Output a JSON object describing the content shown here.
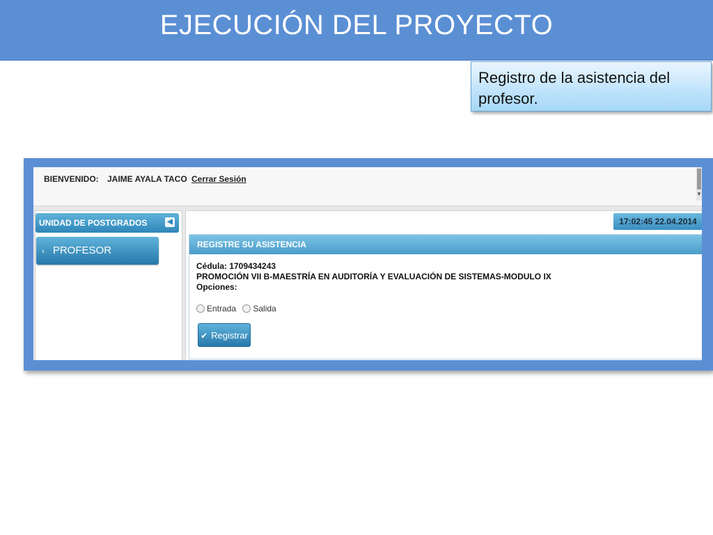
{
  "slide": {
    "title": "EJECUCIÓN DEL PROYECTO",
    "callout": "Registro de la asistencia del profesor."
  },
  "app": {
    "topbar": {
      "welcome_label": "BIENVENIDO:",
      "username": "JAIME AYALA TACO",
      "logout_label": "Cerrar Sesión"
    },
    "sidebar": {
      "header": "UNIDAD DE POSTGRADOS",
      "collapse_icon": "chevron-left-icon",
      "items": [
        {
          "label": "PROFESOR",
          "icon": "chevron-right-icon"
        }
      ]
    },
    "clock": "17:02:45 22.04.2014",
    "panel": {
      "header": "REGISTRE SU ASISTENCIA",
      "cedula": "Cédula: 1709434243",
      "promotion": "PROMOCIÓN VII B-MAESTRÍA EN AUDITORÍA Y EVALUACIÓN DE SISTEMAS-MODULO IX",
      "options_label": "Opciones:",
      "options": [
        {
          "label": "Entrada",
          "selected": false
        },
        {
          "label": "Salida",
          "selected": false
        }
      ],
      "submit_label": "Registrar",
      "submit_icon": "check-icon"
    }
  },
  "colors": {
    "slide_accent": "#5b8fd4",
    "app_accent": "#2f86b8"
  }
}
